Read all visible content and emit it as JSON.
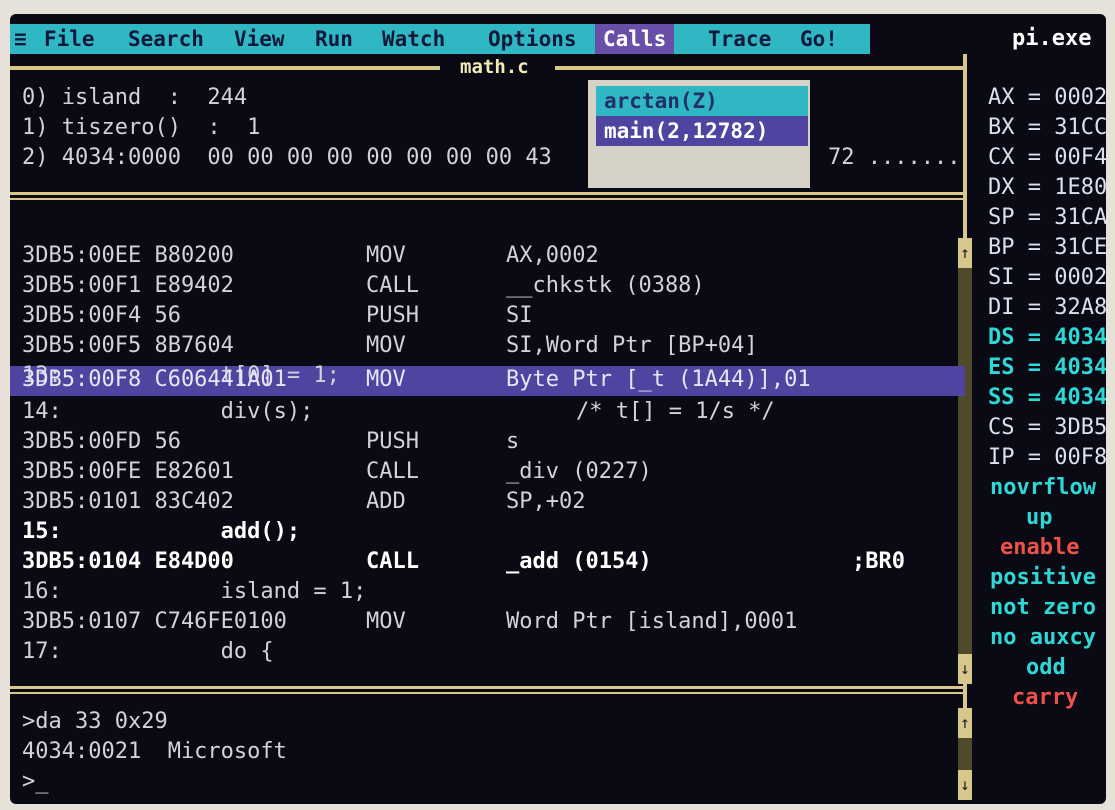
{
  "menu": {
    "items": [
      "File",
      "Search",
      "View",
      "Run",
      "Watch",
      "Options",
      "Calls",
      "Trace",
      "Go!"
    ],
    "active": "Calls",
    "app": "pi.exe"
  },
  "source_title": "math.c",
  "watch": [
    "0) island  :  244",
    "1) tiszero()  :  1",
    "2) 4034:0000  00 00 00 00 00 00 00 00 43"
  ],
  "watch_tail": "72 .......",
  "calls_menu": [
    "arctan(Z)",
    "main(2,12782)"
  ],
  "code": [
    {
      "addr": "3DB5:00EE B80200",
      "op": "MOV",
      "arg": "AX,0002"
    },
    {
      "addr": "3DB5:00F1 E89402",
      "op": "CALL",
      "arg": "__chkstk (0388)"
    },
    {
      "addr": "3DB5:00F4 56",
      "op": "PUSH",
      "arg": "SI"
    },
    {
      "addr": "3DB5:00F5 8B7604",
      "op": "MOV",
      "arg": "SI,Word Ptr [BP+04]"
    },
    {
      "src": "13:            t[0] = 1;"
    },
    {
      "addr": "3DB5:00F8 C606441A01",
      "op": "MOV",
      "arg": "Byte Ptr [_t (1A44)],01"
    },
    {
      "src": "14:            div(s);",
      "comment": "/* t[] = 1/s */"
    },
    {
      "addr": "3DB5:00FD 56",
      "op": "PUSH",
      "arg": "s"
    },
    {
      "addr": "3DB5:00FE E82601",
      "op": "CALL",
      "arg": "_div (0227)"
    },
    {
      "addr": "3DB5:0101 83C402",
      "op": "ADD",
      "arg": "SP,+02"
    },
    {
      "src": "15:            add();"
    },
    {
      "addr": "3DB5:0104 E84D00",
      "op": "CALL",
      "arg": "_add (0154)",
      "tag": ";BR0"
    },
    {
      "src": "16:            island = 1;"
    },
    {
      "addr": "3DB5:0107 C746FE0100",
      "op": "MOV",
      "arg": "Word Ptr [island],0001"
    },
    {
      "src": "17:            do {"
    }
  ],
  "registers": [
    "AX = 0002",
    "BX = 31CC",
    "CX = 00F4",
    "DX = 1E80",
    "SP = 31CA",
    "BP = 31CE",
    "SI = 0002",
    "DI = 32A8",
    "DS = 4034",
    "ES = 4034",
    "SS = 4034",
    "CS = 3DB5",
    "IP = 00F8"
  ],
  "flags": [
    "novrflow",
    "up",
    "enable",
    "positive",
    "not zero",
    "no auxcy",
    "odd",
    "carry"
  ],
  "colors": {
    "accent": "#30b7c4",
    "highlight": "#4f44a0",
    "flag_red": "#f0504a",
    "flag_cyan": "#2fd8d6",
    "frame": "#d7c78a"
  },
  "dialog": {
    "lines": [
      ">da 33 0x29",
      "4034:0021  Microsoft"
    ],
    "prompt": ">_"
  }
}
